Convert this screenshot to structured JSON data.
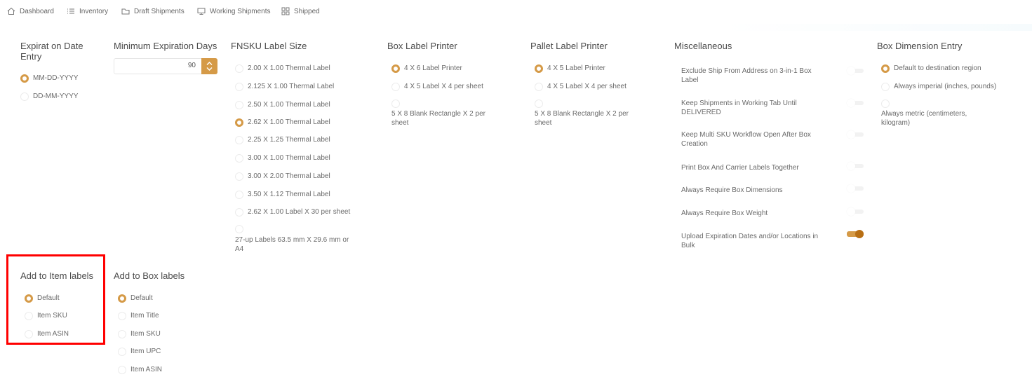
{
  "nav": {
    "items": [
      {
        "label": "Dashboard",
        "icon": "home-icon"
      },
      {
        "label": "Inventory",
        "icon": "list-icon"
      },
      {
        "label": "Draft Shipments",
        "icon": "folder-icon"
      },
      {
        "label": "Working Shipments",
        "icon": "monitor-icon"
      },
      {
        "label": "Shipped",
        "icon": "grid-icon"
      }
    ]
  },
  "expiration": {
    "title": "Expirat on Date Entry",
    "options": [
      {
        "label": "MM-DD-YYYY",
        "checked": true
      },
      {
        "label": "DD-MM-YYYY",
        "checked": false
      }
    ]
  },
  "min_exp": {
    "title": "Minimum Expiration Days",
    "value": "90"
  },
  "fnsku": {
    "title": "FNSKU Label Size",
    "options": [
      {
        "label": "2.00 X 1.00 Thermal Label",
        "checked": false
      },
      {
        "label": "2.125 X 1.00 Thermal Label",
        "checked": false
      },
      {
        "label": "2.50 X 1.00 Thermal Label",
        "checked": false
      },
      {
        "label": "2.62 X 1.00 Thermal Label",
        "checked": true
      },
      {
        "label": "2.25 X 1.25 Thermal Label",
        "checked": false
      },
      {
        "label": "3.00 X 1.00 Thermal Label",
        "checked": false
      },
      {
        "label": "3.00 X 2.00 Thermal Label",
        "checked": false
      },
      {
        "label": "3.50 X 1.12 Thermal Label",
        "checked": false
      },
      {
        "label": "2.62 X 1.00 Label X 30 per sheet",
        "checked": false
      },
      {
        "label": "27-up Labels 63.5 mm X 29.6 mm or A4",
        "checked": false
      }
    ]
  },
  "box_printer": {
    "title": "Box Label Printer",
    "options": [
      {
        "label": "4 X 6 Label Printer",
        "checked": true
      },
      {
        "label": "4 X 5 Label X 4 per sheet",
        "checked": false
      },
      {
        "label": "5 X 8 Blank Rectangle X 2 per sheet",
        "checked": false
      }
    ]
  },
  "pallet_printer": {
    "title": "Pallet Label Printer",
    "options": [
      {
        "label": "4 X 5 Label Printer",
        "checked": true
      },
      {
        "label": "4 X 5 Label X 4 per sheet",
        "checked": false
      },
      {
        "label": "5 X 8 Blank Rectangle X 2 per sheet",
        "checked": false
      }
    ]
  },
  "misc": {
    "title": "Miscellaneous",
    "rows": [
      {
        "label": "Exclude Ship From Address on 3-in-1 Box Label",
        "on": false
      },
      {
        "label": "Keep Shipments in Working Tab Until DELIVERED",
        "on": false
      },
      {
        "label": "Keep Multi SKU Workflow Open After Box Creation",
        "on": false
      },
      {
        "label": "Print Box And Carrier Labels Together",
        "on": false
      },
      {
        "label": "Always Require Box Dimensions",
        "on": false
      },
      {
        "label": "Always Require Box Weight",
        "on": false
      },
      {
        "label": "Upload Expiration Dates and/or Locations in Bulk",
        "on": true
      }
    ]
  },
  "box_dim": {
    "title": "Box Dimension Entry",
    "options": [
      {
        "label": "Default to destination region",
        "checked": true
      },
      {
        "label": "Always imperial (inches, pounds)",
        "checked": false
      },
      {
        "label": "Always metric (centimeters, kilogram)",
        "checked": false
      }
    ]
  },
  "item_labels": {
    "title": "Add to Item labels",
    "options": [
      {
        "label": "Default",
        "checked": true
      },
      {
        "label": "Item SKU",
        "checked": false
      },
      {
        "label": "Item ASIN",
        "checked": false
      }
    ]
  },
  "box_labels": {
    "title": "Add to Box labels",
    "options": [
      {
        "label": "Default",
        "checked": true
      },
      {
        "label": "Item Title",
        "checked": false
      },
      {
        "label": "Item SKU",
        "checked": false
      },
      {
        "label": "Item UPC",
        "checked": false
      },
      {
        "label": "Item ASIN",
        "checked": false
      }
    ]
  },
  "colors": {
    "accent": "#d59a47",
    "toggle_on_knob": "#b86f14",
    "highlight": "#ff0000"
  }
}
